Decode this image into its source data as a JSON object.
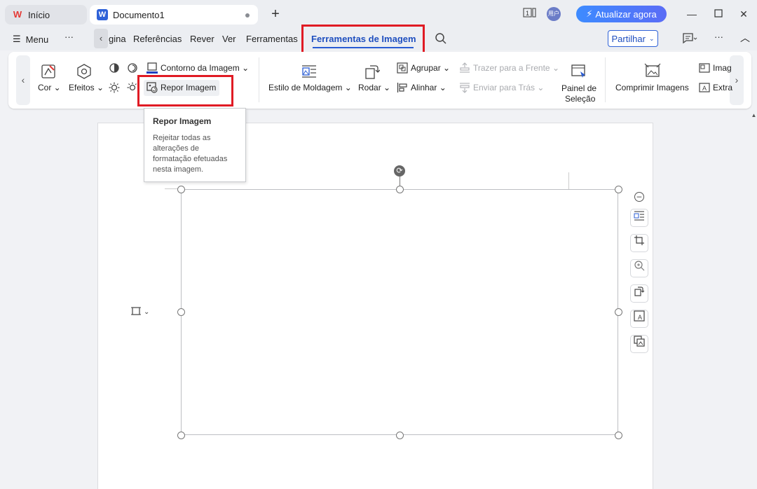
{
  "titlebar": {
    "home_tab": "Início",
    "doc_tab": "Documento1",
    "new_tab": "+",
    "page_indicator": "1",
    "avatar_text": "用户",
    "upgrade_label": "Atualizar agora"
  },
  "menu": {
    "menu_label": "Menu",
    "more": "···",
    "items": [
      "gina",
      "Referências",
      "Rever",
      "Ver",
      "Ferramentas"
    ],
    "active_tab": "Ferramentas de Imagem",
    "share_label": "Partilhar"
  },
  "ribbon": {
    "cor": "Cor",
    "efeitos": "Efeitos",
    "contorno": "Contorno da Imagem",
    "repor": "Repor Imagem",
    "estilo": "Estilo de Moldagem",
    "rodar": "Rodar",
    "agrupar": "Agrupar",
    "alinhar": "Alinhar",
    "trazer": "Trazer para a Frente",
    "enviar": "Enviar para Trás",
    "painel_line1": "Painel de",
    "painel_line2": "Seleção",
    "comprimir": "Comprimir Imagens",
    "imag": "Imag",
    "extra": "Extra"
  },
  "tooltip": {
    "title": "Repor Imagem",
    "line1": "Rejeitar todas as",
    "line2": "alterações de",
    "line3": "formatação efetuadas",
    "line4": "nesta imagem."
  },
  "icons": {
    "accent": "#2a5cd3",
    "highlight": "#e01b24"
  }
}
